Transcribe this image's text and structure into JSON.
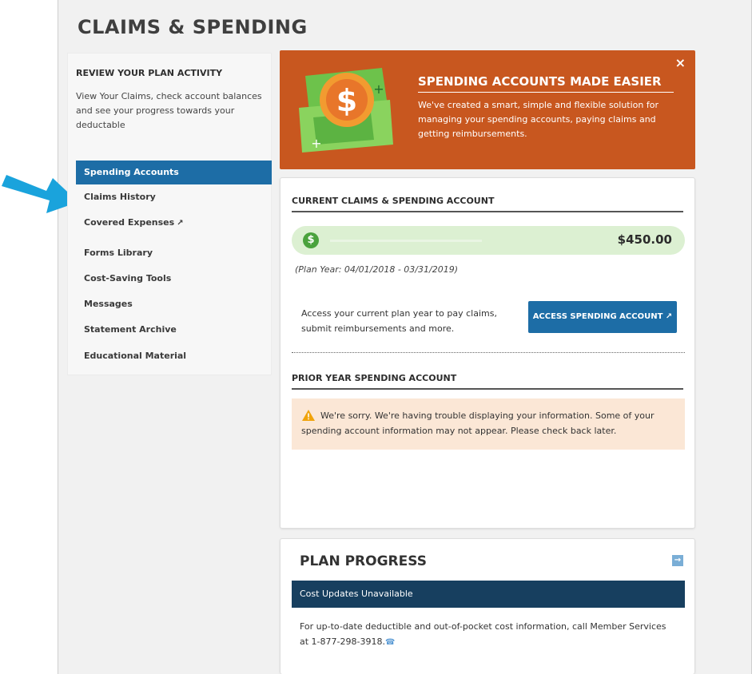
{
  "page": {
    "title": "CLAIMS & SPENDING"
  },
  "sidebar": {
    "heading": "REVIEW YOUR PLAN ACTIVITY",
    "description": "View Your Claims, check account balances and see your progress towards your deductable",
    "items": [
      {
        "label": "Spending Accounts",
        "active": true
      },
      {
        "label": "Claims History"
      },
      {
        "label": "Covered Expenses",
        "external": true
      },
      {
        "label": "Forms Library"
      },
      {
        "label": "Cost-Saving Tools"
      },
      {
        "label": "Messages"
      },
      {
        "label": "Statement Archive"
      },
      {
        "label": "Educational Material"
      }
    ]
  },
  "promo": {
    "title": "SPENDING ACCOUNTS MADE EASIER",
    "text": "We've created a smart, simple and flexible solution for managing your spending accounts, paying claims and getting reimbursements.",
    "close_label": "×"
  },
  "current": {
    "heading": "CURRENT CLAIMS & SPENDING ACCOUNT",
    "balance_icon": "$",
    "balance": "$450.00",
    "plan_year": "(Plan Year: 04/01/2018 - 03/31/2019)",
    "access_text": "Access your current plan year to pay claims, submit reimbursements and more.",
    "access_button": "ACCESS SPENDING ACCOUNT"
  },
  "prior": {
    "heading": "PRIOR YEAR SPENDING ACCOUNT",
    "warning": "We're sorry. We're having trouble displaying your information. Some of your spending account information may not appear. Please check back later."
  },
  "progress": {
    "title": "PLAN PROGRESS",
    "banner": "Cost Updates Unavailable",
    "text": "For up-to-date deductible and out-of-pocket cost information, call Member Services at 1-877-298-3918."
  },
  "icons": {
    "arrow": "blue-arrow-pointer",
    "external": "external-link-icon",
    "warning": "warning-triangle-icon",
    "phone": "phone-icon",
    "expand": "arrow-right-icon"
  },
  "colors": {
    "accent_blue": "#1d6da6",
    "promo_orange": "#c8571f",
    "balance_green": "#dcf0d2",
    "warning_bg": "#fbe7d6",
    "banner_navy": "#173f5f"
  }
}
